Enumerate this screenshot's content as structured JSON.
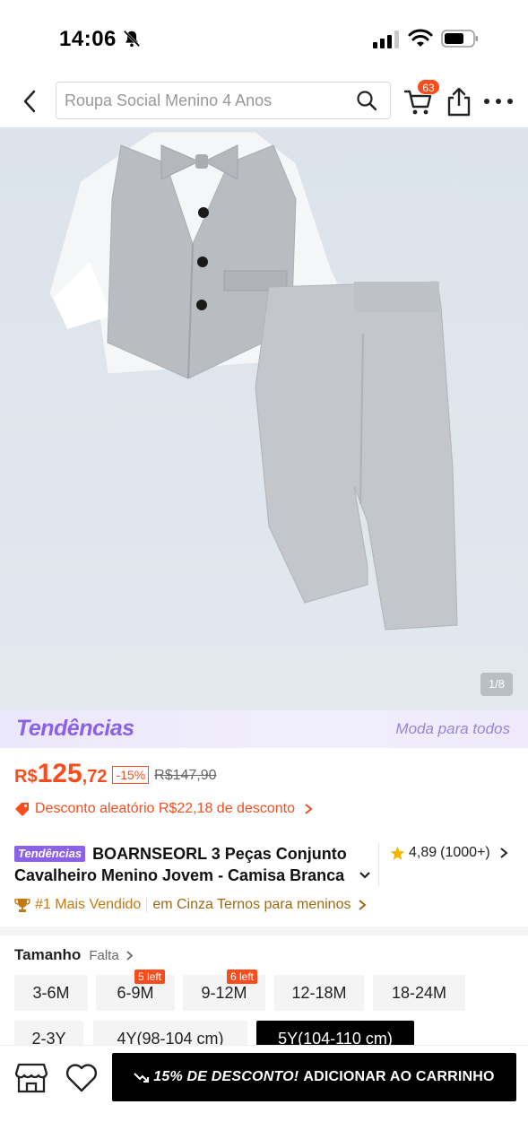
{
  "status_bar": {
    "time": "14:06"
  },
  "header": {
    "search_placeholder": "Roupa Social Menino 4 Anos",
    "cart_count": "63"
  },
  "gallery": {
    "counter": "1/8"
  },
  "trends": {
    "logo": "Tendências",
    "tagline": "Moda para todos"
  },
  "price": {
    "currency": "R$",
    "integer": "125",
    "decimal": ",72",
    "discount": "-15%",
    "original": "R$147,90"
  },
  "coupon": {
    "text": "Desconto aleatório R$22,18 de desconto"
  },
  "product": {
    "tag": "Tendências",
    "title_line1": "BOARNSEORL 3 Peças Conjunto",
    "title_line2": "Cavalheiro Menino Jovem - Camisa Branca"
  },
  "rating": {
    "score": "4,89",
    "count": "(1000+)"
  },
  "bestseller": {
    "label": "#1 Mais Vendido",
    "category": "em Cinza Ternos para meninos"
  },
  "size": {
    "label": "Tamanho",
    "status": "Falta",
    "options": [
      {
        "label": "3-6M"
      },
      {
        "label": "6-9M",
        "badge": "5 left"
      },
      {
        "label": "9-12M",
        "badge": "6 left"
      },
      {
        "label": "12-18M"
      },
      {
        "label": "18-24M"
      },
      {
        "label": "2-3Y"
      },
      {
        "label": "4Y(98-104 cm)"
      },
      {
        "label": "5Y(104-110 cm)",
        "selected": true
      }
    ]
  },
  "bottom": {
    "promo": "15% DE DESCONTO!",
    "add_to_cart": "ADICIONAR AO CARRINHO"
  },
  "colors": {
    "accent": "#fa4b1c",
    "trends_purple": "#8a61e8",
    "bestseller": "#c47a10"
  }
}
